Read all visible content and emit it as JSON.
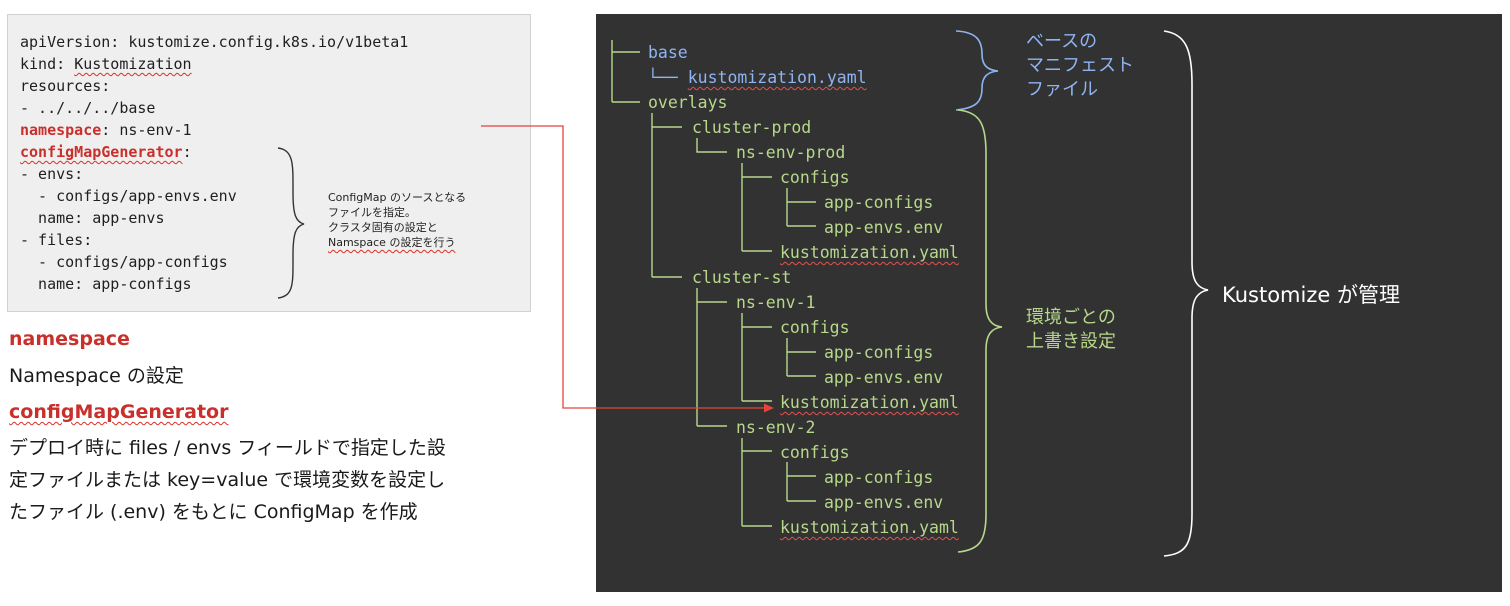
{
  "code": {
    "lines": [
      "apiVersion: kustomize.config.k8s.io/v1beta1",
      "kind: Kustomization",
      "resources:",
      "- ../../../base",
      ": ns-env-1",
      ":",
      "- envs:",
      "  - configs/app-envs.env",
      "  name: app-envs",
      "- files:",
      "  - configs/app-configs",
      "  name: app-configs"
    ],
    "key_namespace": "namespace",
    "key_configmap": "configMapGenerator",
    "kustomization_word": "Kustomization",
    "kind_prefix": "kind: "
  },
  "note": {
    "lines": [
      "ConfigMap のソースとなる",
      "ファイルを指定。",
      "クラスタ固有の設定と",
      "Namspace の設定を行う"
    ]
  },
  "descriptions": {
    "namespace_term": "namespace",
    "namespace_desc": "Namespace の設定",
    "configmap_term": "configMapGenerator",
    "configmap_desc": [
      "デプロイ時に files / envs フィールドで指定した設",
      "定ファイルまたは key=value で環境変数を設定し",
      "たファイル (.env) をもとに ConfigMap を作成"
    ]
  },
  "tree": {
    "base": "base",
    "base_kustomization": "kustomization.yaml",
    "overlays": "overlays",
    "cluster_prod": "cluster-prod",
    "ns_env_prod": "ns-env-prod",
    "cluster_st": "cluster-st",
    "ns_env_1": "ns-env-1",
    "ns_env_2": "ns-env-2",
    "configs": "configs",
    "app_configs": "app-configs",
    "app_envs": "app-envs.env",
    "kustomization": "kustomization.yaml",
    "base_box_chars": "└──"
  },
  "labels": {
    "base_manifest": [
      "ベースの",
      "マニフェスト",
      "ファイル"
    ],
    "overlay_setting": [
      "環境ごとの",
      "上書き設定"
    ],
    "kustomize_managed": "Kustomize が管理"
  },
  "colors": {
    "terminal_bg": "#323232",
    "blue": "#8fb4f2",
    "green": "#b7d88b",
    "red": "#c9302c"
  }
}
